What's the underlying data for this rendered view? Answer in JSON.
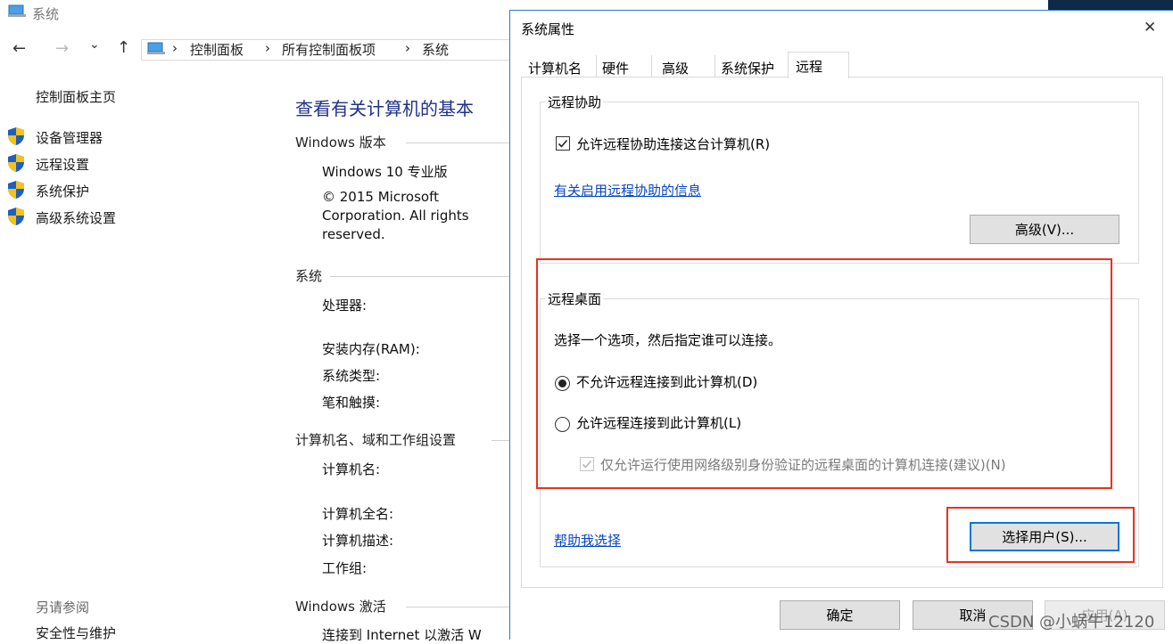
{
  "window": {
    "title": "系统"
  },
  "navbar": {
    "back": "←",
    "forward": "→",
    "history": "⌄",
    "up": "↑",
    "breadcrumbs": [
      "控制面板",
      "所有控制面板项",
      "系统"
    ],
    "sep": "›"
  },
  "sidebar": {
    "home": "控制面板主页",
    "items": [
      {
        "label": "设备管理器"
      },
      {
        "label": "远程设置"
      },
      {
        "label": "系统保护"
      },
      {
        "label": "高级系统设置"
      }
    ],
    "see_also_title": "另请参阅",
    "see_also_first": "安全性与维护"
  },
  "main": {
    "title": "查看有关计算机的基本",
    "edition_section": "Windows 版本",
    "edition": "Windows 10 专业版",
    "copyright_1": "© 2015 Microsoft",
    "copyright_2": "Corporation. All rights",
    "copyright_3": "reserved.",
    "system_section": "系统",
    "processor": "处理器:",
    "ram": "安装内存(RAM):",
    "system_type": "系统类型:",
    "pen_touch": "笔和触摸:",
    "computer_section": "计算机名、域和工作组设置",
    "computer_name": "计算机名:",
    "full_name": "计算机全名:",
    "description": "计算机描述:",
    "workgroup": "工作组:",
    "activation_section": "Windows 激活",
    "activation_text": "连接到 Internet 以激活 W"
  },
  "dialog": {
    "title": "系统属性",
    "close": "✕",
    "tabs": [
      "计算机名",
      "硬件",
      "高级",
      "系统保护",
      "远程"
    ],
    "remote_assist": {
      "title": "远程协助",
      "checkbox_label": "允许远程协助连接这台计算机(R)",
      "checked": true,
      "link": "有关启用远程协助的信息",
      "advanced_button": "高级(V)..."
    },
    "remote_desktop": {
      "title": "远程桌面",
      "prompt": "选择一个选项，然后指定谁可以连接。",
      "option_deny": "不允许远程连接到此计算机(D)",
      "option_allow": "允许远程连接到此计算机(L)",
      "selected": "deny",
      "nla_label": "仅允许运行使用网络级别身份验证的远程桌面的计算机连接(建议)(N)",
      "nla_checked": true,
      "help_link": "帮助我选择",
      "select_users_button": "选择用户(S)..."
    },
    "buttons": {
      "ok": "确定",
      "cancel": "取消",
      "apply": "应用(A)"
    }
  },
  "watermark": "CSDN @小蜗牛12120",
  "colors": {
    "accent": "#0078d7",
    "link": "#0645c4",
    "highlight": "#e8321e"
  }
}
